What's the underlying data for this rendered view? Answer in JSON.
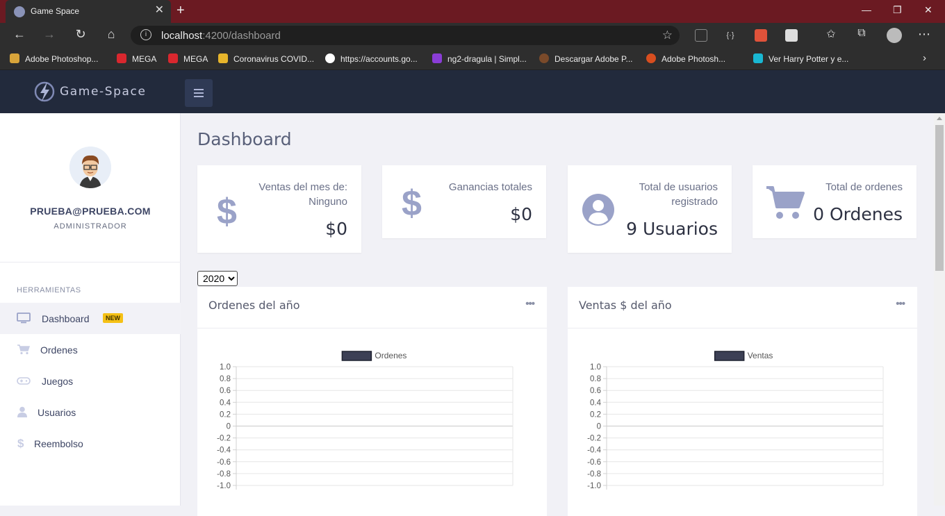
{
  "browser": {
    "tab_title": "Game Space",
    "tab_close": "✕",
    "new_tab": "+",
    "url_host": "localhost",
    "url_rest": ":4200/dashboard",
    "window_controls": [
      "—",
      "❐",
      "✕"
    ],
    "bookmarks": [
      {
        "label": "Adobe Photoshop...",
        "color": "#d8a43a"
      },
      {
        "label": "MEGA",
        "color": "#d9272e"
      },
      {
        "label": "MEGA",
        "color": "#d9272e"
      },
      {
        "label": "Coronavirus COVID...",
        "color": "#e7b52b"
      },
      {
        "label": "https://accounts.go...",
        "color": "#ffffff"
      },
      {
        "label": "ng2-dragula | Simpl...",
        "color": "#8a3dd6"
      },
      {
        "label": "Descargar Adobe P...",
        "color": "#7a4a2a"
      },
      {
        "label": "Adobe Photosh...",
        "color": "#d84e1f"
      },
      {
        "label": "Ver Harry Potter y e...",
        "color": "#19b7d2"
      }
    ]
  },
  "app": {
    "logo_text": "Game-Space",
    "profile": {
      "email": "PRUEBA@PRUEBA.COM",
      "role": "ADMINISTRADOR"
    },
    "sidebar": {
      "section_label": "HERRAMIENTAS",
      "items": [
        {
          "label": "Dashboard",
          "icon": "monitor-icon",
          "badge": "NEW"
        },
        {
          "label": "Ordenes",
          "icon": "cart-icon"
        },
        {
          "label": "Juegos",
          "icon": "gamepad-icon"
        },
        {
          "label": "Usuarios",
          "icon": "user-icon"
        },
        {
          "label": "Reembolso",
          "icon": "dollar-icon"
        }
      ]
    },
    "page_title": "Dashboard",
    "cards": [
      {
        "label_line1": "Ventas del mes de:",
        "label_line2": "Ninguno",
        "value": "$0",
        "icon": "dollar-icon"
      },
      {
        "label_line1": "Ganancias totales",
        "label_line2": "",
        "value": "$0",
        "icon": "dollar-icon"
      },
      {
        "label_line1": "Total de usuarios",
        "label_line2": "registrado",
        "value": "9 Usuarios",
        "icon": "user-circle-icon"
      },
      {
        "label_line1": "Total de ordenes",
        "label_line2": "",
        "value": "0 Ordenes",
        "icon": "cart-icon"
      }
    ],
    "year_select": {
      "selected": "2020"
    },
    "accent_color": "#9aa2c8"
  },
  "chart_data": [
    {
      "type": "line",
      "title": "Ordenes del año",
      "legend": "Ordenes",
      "legend_position": "top",
      "series": [
        {
          "name": "Ordenes",
          "values": []
        }
      ],
      "ylim": [
        -1.0,
        1.0
      ],
      "yticks": [
        "1.0",
        "0.8",
        "0.6",
        "0.4",
        "0.2",
        "0",
        "-0.2",
        "-0.4",
        "-0.6",
        "-0.8",
        "-1.0"
      ],
      "grid": true,
      "series_color": "#3c4055"
    },
    {
      "type": "line",
      "title": "Ventas $ del año",
      "legend": "Ventas",
      "legend_position": "top",
      "series": [
        {
          "name": "Ventas",
          "values": []
        }
      ],
      "ylim": [
        -1.0,
        1.0
      ],
      "yticks": [
        "1.0",
        "0.8",
        "0.6",
        "0.4",
        "0.2",
        "0",
        "-0.2",
        "-0.4",
        "-0.6",
        "-0.8",
        "-1.0"
      ],
      "grid": true,
      "series_color": "#3c4055"
    }
  ]
}
